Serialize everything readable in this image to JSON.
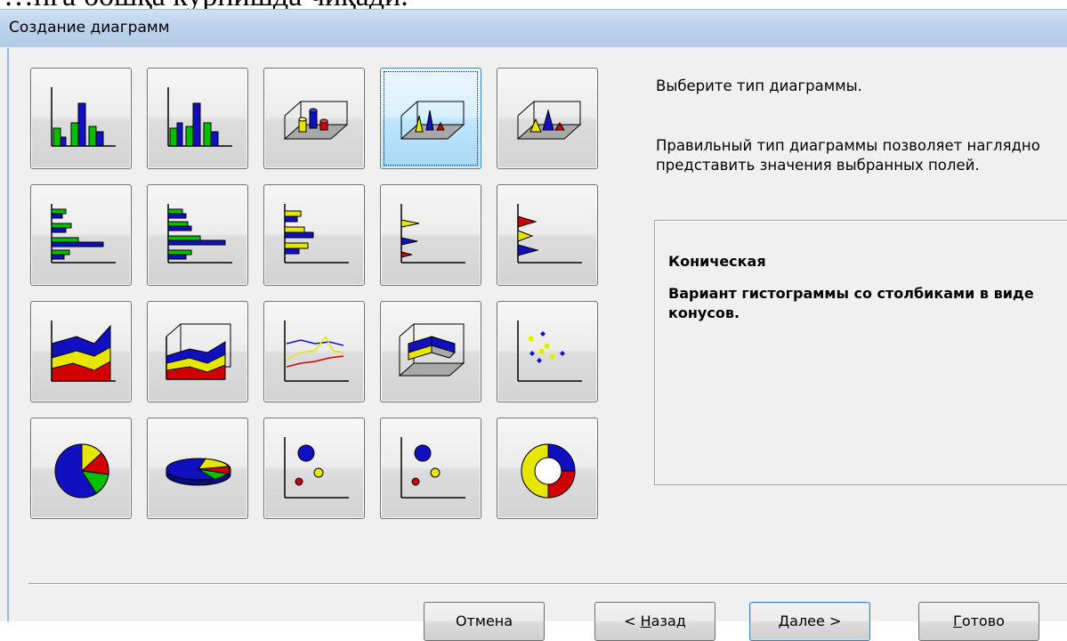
{
  "page": {
    "visible_text": "…нга бошқа курнишда чиқади."
  },
  "dialog": {
    "title": "Создание диаграмм",
    "hint_primary": "Выберите тип диаграммы.",
    "hint_secondary": "Правильный тип диаграммы позволяет наглядно представить значения выбранных полей.",
    "info": {
      "type_name": "Коническая",
      "description": "Вариант гистограммы со столбиками в виде конусов."
    },
    "chart_types": [
      {
        "icon": "clustered-column-chart-icon",
        "selected": false
      },
      {
        "icon": "stacked-column-chart-icon",
        "selected": false
      },
      {
        "icon": "3d-cylinder-chart-icon",
        "selected": false
      },
      {
        "icon": "3d-cone-chart-icon",
        "selected": true
      },
      {
        "icon": "3d-pyramid-chart-icon",
        "selected": false
      },
      {
        "icon": "clustered-bar-chart-icon",
        "selected": false
      },
      {
        "icon": "stacked-bar-chart-icon",
        "selected": false
      },
      {
        "icon": "bar-chart-variant-icon",
        "selected": false
      },
      {
        "icon": "cone-bar-chart-icon",
        "selected": false
      },
      {
        "icon": "pyramid-bar-chart-icon",
        "selected": false
      },
      {
        "icon": "area-chart-icon",
        "selected": false
      },
      {
        "icon": "3d-area-chart-icon",
        "selected": false
      },
      {
        "icon": "line-chart-icon",
        "selected": false
      },
      {
        "icon": "3d-surface-chart-icon",
        "selected": false
      },
      {
        "icon": "scatter-chart-icon",
        "selected": false
      },
      {
        "icon": "pie-chart-icon",
        "selected": false
      },
      {
        "icon": "3d-pie-chart-icon",
        "selected": false
      },
      {
        "icon": "bubble-chart-icon",
        "selected": false
      },
      {
        "icon": "3d-bubble-chart-icon",
        "selected": false
      },
      {
        "icon": "doughnut-chart-icon",
        "selected": false
      }
    ],
    "buttons": {
      "cancel": "Отмена",
      "back_prefix": "< ",
      "back_mnemonic": "Н",
      "back_rest": "азад",
      "next_mnemonic": "Д",
      "next_rest": "алее >",
      "finish_mnemonic": "Г",
      "finish_rest": "отово"
    }
  }
}
